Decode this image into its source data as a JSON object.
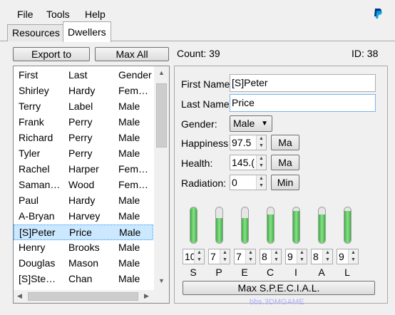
{
  "menu": {
    "file": "File",
    "tools": "Tools",
    "help": "Help",
    "paypal_icon": "paypal-icon"
  },
  "tabs": {
    "resources": "Resources",
    "dwellers": "Dwellers"
  },
  "toolbar": {
    "export_label": "Export to",
    "max_all_label": "Max All",
    "count_label": "Count: 39",
    "id_label": "ID: 38"
  },
  "list": {
    "columns": [
      "First",
      "Last",
      "Gender"
    ],
    "rows": [
      [
        "Shirley",
        "Hardy",
        "Fem…"
      ],
      [
        "Terry",
        "Label",
        "Male"
      ],
      [
        "Frank",
        "Perry",
        "Male"
      ],
      [
        "Richard",
        "Perry",
        "Male"
      ],
      [
        "Tyler",
        "Perry",
        "Male"
      ],
      [
        "Rachel",
        "Harper",
        "Fem…"
      ],
      [
        "Saman…",
        "Wood",
        "Fem…"
      ],
      [
        "Paul",
        "Hardy",
        "Male"
      ],
      [
        "A-Bryan",
        "Harvey",
        "Male"
      ],
      [
        "[S]Peter",
        "Price",
        "Male"
      ],
      [
        "Henry",
        "Brooks",
        "Male"
      ],
      [
        "Douglas",
        "Mason",
        "Male"
      ],
      [
        "[S]Ste…",
        "Chan",
        "Male"
      ]
    ],
    "selected_index": 9
  },
  "detail": {
    "first_name_label": "First Name",
    "first_name_value": "[S]Peter",
    "last_name_label": "Last Name",
    "last_name_value": "Price",
    "gender_label": "Gender:",
    "gender_value": "Male",
    "happiness_label": "Happiness",
    "happiness_value": "97.5",
    "happiness_max": "Ma",
    "health_label": "Health:",
    "health_value": "145.(",
    "health_max": "Ma",
    "radiation_label": "Radiation:",
    "radiation_value": "0",
    "radiation_min": "Min",
    "max_special_label": "Max S.P.E.C.I.A.L."
  },
  "special": [
    {
      "letter": "S",
      "value": "10",
      "level": 1.0
    },
    {
      "letter": "P",
      "value": "7",
      "level": 0.7
    },
    {
      "letter": "E",
      "value": "7",
      "level": 0.7
    },
    {
      "letter": "C",
      "value": "8",
      "level": 0.8
    },
    {
      "letter": "I",
      "value": "9",
      "level": 0.9
    },
    {
      "letter": "A",
      "value": "8",
      "level": 0.8
    },
    {
      "letter": "L",
      "value": "9",
      "level": 0.9
    }
  ],
  "colors": {
    "accent": "#3399ff",
    "bar_green": "#3cb043",
    "selected_row": "#cce8ff"
  },
  "watermark": "bbs.3DMGAME"
}
